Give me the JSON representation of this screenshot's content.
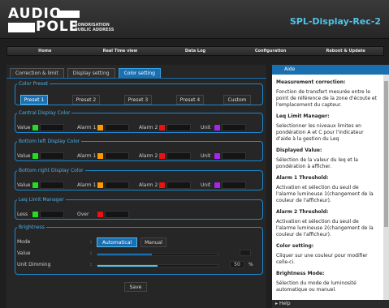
{
  "header": {
    "logo_top": "AUDIO",
    "logo_bottom": "POLE",
    "tagline_line1": "SONORISATION",
    "tagline_line2": "PUBLIC ADDRESS",
    "device_title": "SPL-Display-Rec-2"
  },
  "nav": [
    "Home",
    "Real Time view",
    "Data Log",
    "Configuration",
    "Reboot & Update"
  ],
  "tabs": [
    "Correction & limit",
    "Display setting",
    "Color setting"
  ],
  "active_tab": "Color setting",
  "color_preset": {
    "legend": "Color Preset",
    "options": [
      "Preset 1",
      "Preset 2",
      "Preset 3",
      "Preset 4",
      "Custom"
    ],
    "selected": "Preset 1"
  },
  "central_display": {
    "legend": "Central Display Color",
    "items": [
      {
        "label": "Value",
        "color": "#22dd22"
      },
      {
        "label": "Alarm 1",
        "color": "#ff9900"
      },
      {
        "label": "Alarm 2",
        "color": "#ee1111"
      },
      {
        "label": "Unit",
        "color": "#aa22ee"
      }
    ]
  },
  "bottom_left": {
    "legend": "Bottom left Display Color",
    "items": [
      {
        "label": "Value",
        "color": "#22dd22"
      },
      {
        "label": "Alarm 1",
        "color": "#ff9900"
      },
      {
        "label": "Alarm 2",
        "color": "#ee1111"
      },
      {
        "label": "Unit",
        "color": "#aa22ee"
      }
    ]
  },
  "bottom_right": {
    "legend": "Bottom right Display Color",
    "items": [
      {
        "label": "Value",
        "color": "#22dd22"
      },
      {
        "label": "Alarm 1",
        "color": "#ff9900"
      },
      {
        "label": "Alarm 2",
        "color": "#ee1111"
      },
      {
        "label": "Unit",
        "color": "#aa22ee"
      }
    ]
  },
  "leq_limit": {
    "legend": "Leq Limit Manager",
    "items": [
      {
        "label": "Less",
        "color": "#22dd22"
      },
      {
        "label": "Over",
        "color": "#ee1111"
      }
    ]
  },
  "brightness": {
    "legend": "Brightness",
    "mode_label": "Mode",
    "value_label": "Value",
    "dimming_label": "Unit Dimming",
    "colon": ":",
    "mode_options": [
      "Automatical",
      "Manual"
    ],
    "mode_selected": "Automatical",
    "value_fraction": 0.45,
    "dimming_value": "50",
    "dimming_fraction": 0.5,
    "dimming_unit": "%"
  },
  "save_label": "Save",
  "help": {
    "title": "Aide",
    "sections": [
      {
        "heading": "Measurement correction:",
        "text": "Fonction de transfert mesurée entre le point de référence de la zone d'écoute et l'emplacement du capteur."
      },
      {
        "heading": "Leq Limit Manager:",
        "text": "Selectionner les niveaux limites en pondération A et C pour l'indicateur d'aide à la gestion du Leq"
      },
      {
        "heading": "Displayed Value:",
        "text": "Sélection de la valeur du leq et la pondération à afficher."
      },
      {
        "heading": "Alarm 1 Threshold:",
        "text": "Activation et sélection du seuil de l'alarme lumineuse 1(changement de la couleur de l'afficheur)."
      },
      {
        "heading": "Alarm 2 Threshold:",
        "text": "Activation et sélection du seuil de l'alarme lumineuse 2(changement de la couleur de l'afficheur)."
      },
      {
        "heading": "Color setting:",
        "text": "Cliquer sur une couleur pour modifier celle-ci."
      },
      {
        "heading": "Brightness Mode:",
        "text": "Sélection du mode de luminosité automatique ou manuel."
      }
    ],
    "footer": "Help"
  },
  "colors": {
    "accent": "#1a6fb0",
    "title": "#4fc3e8"
  }
}
